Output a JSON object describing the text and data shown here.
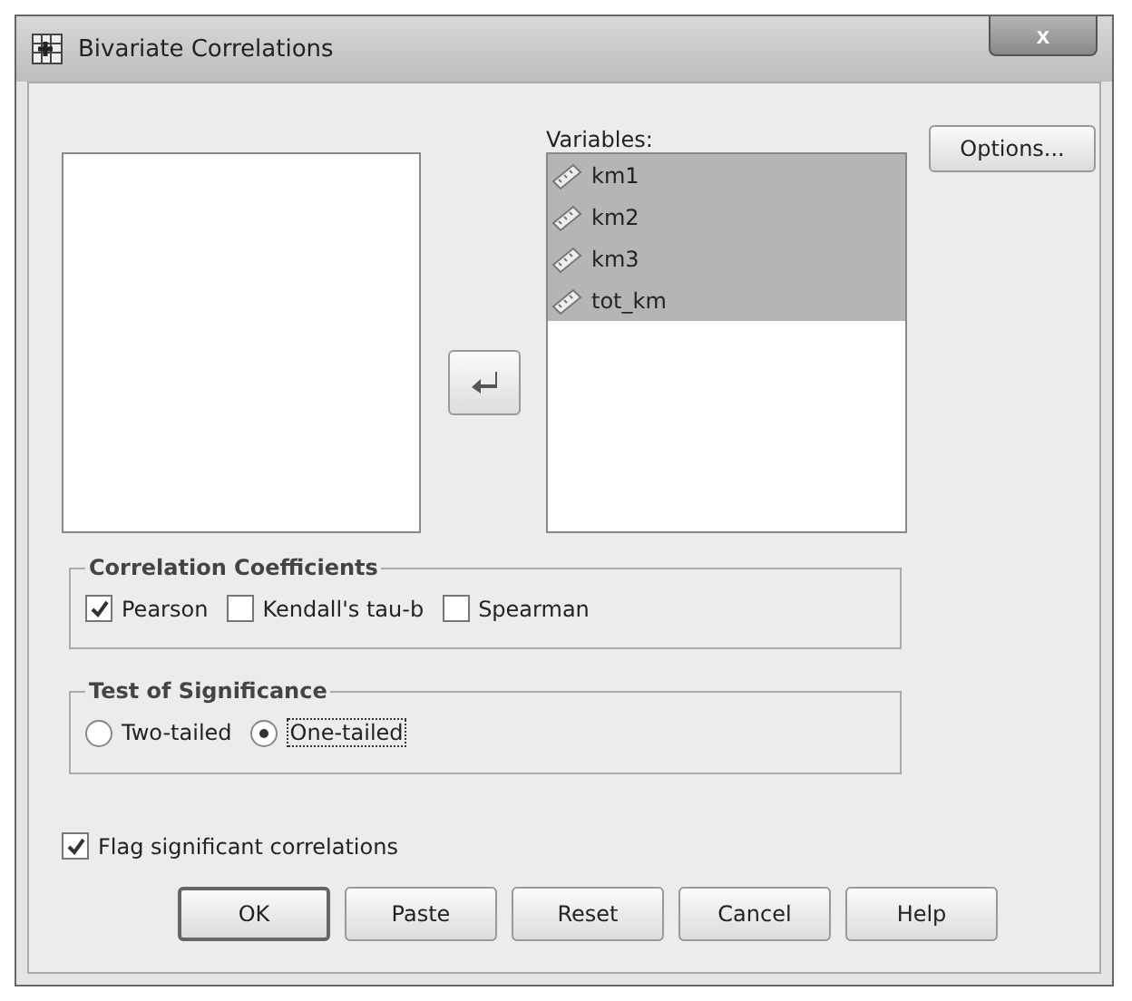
{
  "window": {
    "title": "Bivariate Correlations",
    "close": "x"
  },
  "variables": {
    "label": "Variables:",
    "items": [
      {
        "name": "km1",
        "selected": true
      },
      {
        "name": "km2",
        "selected": true
      },
      {
        "name": "km3",
        "selected": true
      },
      {
        "name": "tot_km",
        "selected": true
      }
    ]
  },
  "options_button": "Options...",
  "correlation_coefficients": {
    "title": "Correlation Coefficients",
    "options": [
      {
        "label": "Pearson",
        "checked": true
      },
      {
        "label": "Kendall's tau-b",
        "checked": false
      },
      {
        "label": "Spearman",
        "checked": false
      }
    ]
  },
  "test_of_significance": {
    "title": "Test of Significance",
    "options": [
      {
        "label": "Two-tailed",
        "selected": false
      },
      {
        "label": "One-tailed",
        "selected": true
      }
    ]
  },
  "flag_significant": {
    "label": "Flag significant correlations",
    "checked": true
  },
  "buttons": [
    {
      "label": "OK",
      "default": true
    },
    {
      "label": "Paste",
      "default": false
    },
    {
      "label": "Reset",
      "default": false
    },
    {
      "label": "Cancel",
      "default": false
    },
    {
      "label": "Help",
      "default": false
    }
  ]
}
